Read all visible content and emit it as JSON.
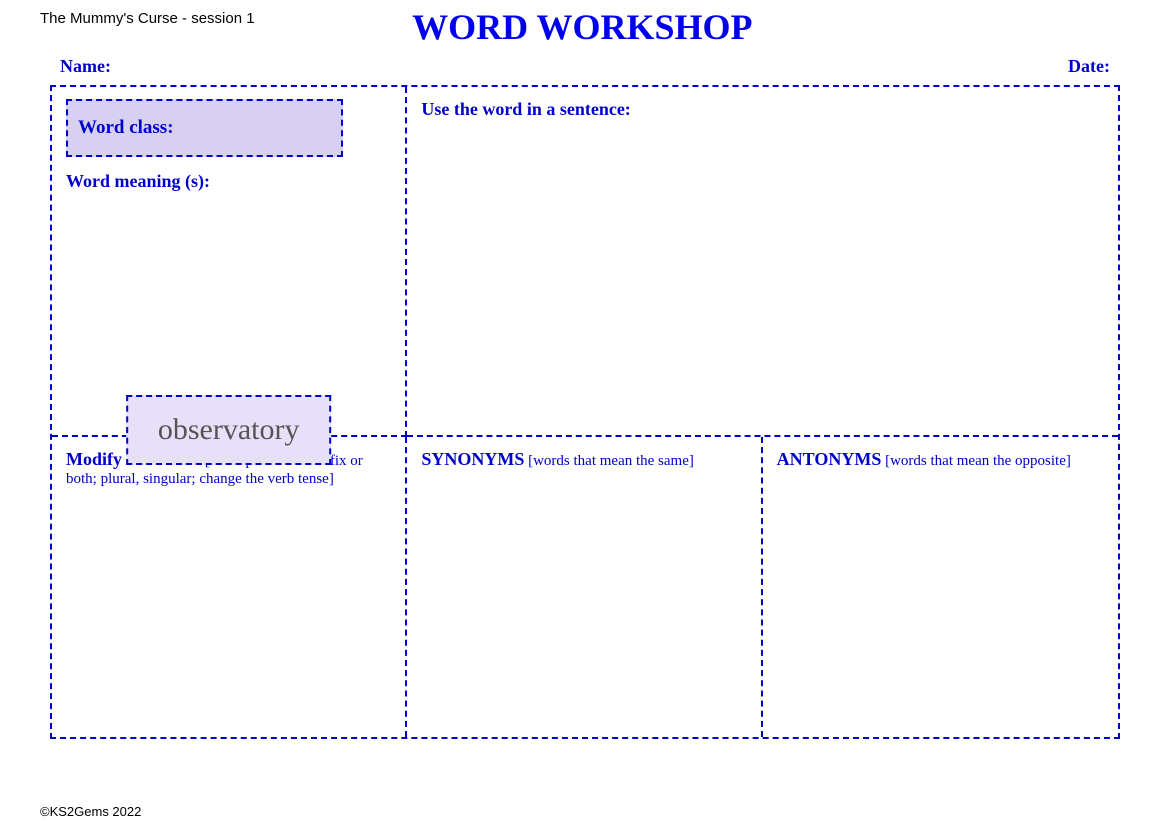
{
  "header": {
    "subtitle": "The Mummy's Curse - session 1",
    "title": "WORD WORKSHOP"
  },
  "name_label": "Name:",
  "date_label": "Date:",
  "top_left": {
    "word_class_label": "Word class:",
    "word_meaning_label": "Word meaning (s):"
  },
  "top_right": {
    "sentence_label": "Use the word in a sentence:"
  },
  "center_word": "observatory",
  "bottom_left": {
    "label_bold": "Modify the word:",
    "label_normal": " [add a prefix or a suffix or both; plural, singular; change the verb tense]"
  },
  "bottom_middle": {
    "label_bold": "SYNONYMS",
    "label_normal": " [words that mean the same]"
  },
  "bottom_right": {
    "label_bold": "ANTONYMS",
    "label_normal": " [words that mean the opposite]"
  },
  "footer": "©KS2Gems 2022"
}
